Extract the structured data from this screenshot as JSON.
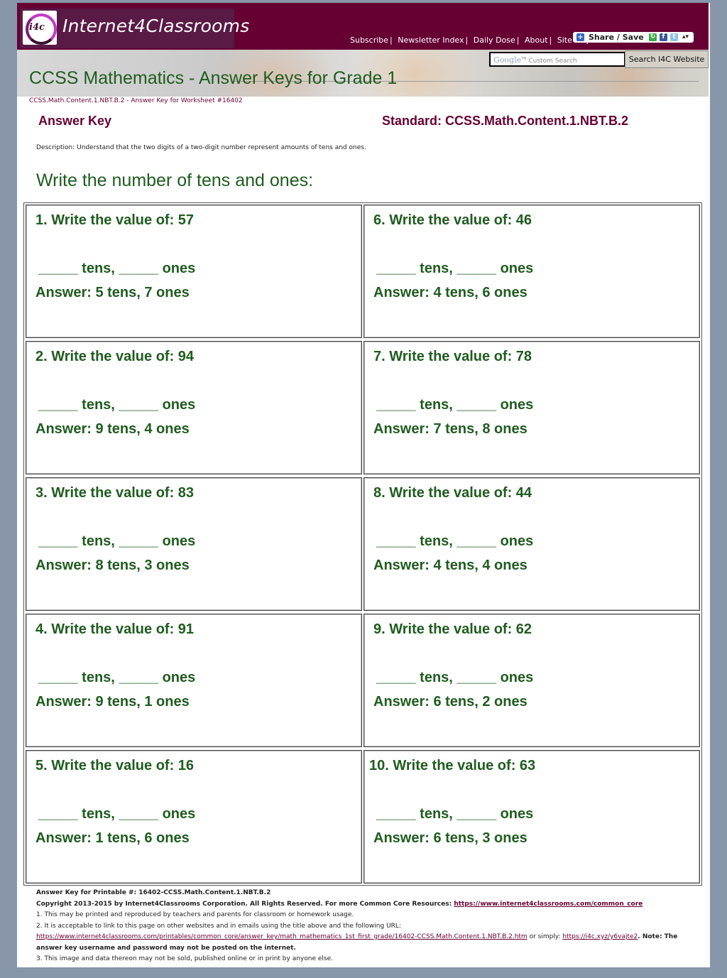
{
  "header": {
    "logo_badge": "i4c",
    "site_name": "Internet4Classrooms",
    "nav_links": [
      {
        "label": "Subscribe"
      },
      {
        "label": "Newsletter Index"
      },
      {
        "label": "Daily Dose"
      },
      {
        "label": "About"
      },
      {
        "label": "Site Map"
      }
    ],
    "share_label": "Share / Save",
    "share_icons": [
      "google-plus-icon",
      "facebook-icon",
      "twitter-icon"
    ],
    "search": {
      "brand": "Google",
      "placeholder": "Custom Search",
      "button_label": "Search I4C Website"
    },
    "page_title": "CCSS Mathematics - Answer Keys for Grade 1",
    "breadcrumb": "CCSS.Math.Content.1.NBT.B.2 - Answer Key for Worksheet #16402"
  },
  "main": {
    "answer_key_heading": "Answer Key",
    "standard_heading": "Standard: CCSS.Math.Content.1.NBT.B.2",
    "description": "Description: Understand that the two digits of a two-digit number represent amounts of tens and ones.",
    "worksheet_title": "Write the number of tens and ones:",
    "blank_template": "_____ tens, _____ ones",
    "problems": [
      {
        "number": 1,
        "question": "1. Write the value of: 57",
        "answer": "Answer: 5 tens, 7 ones"
      },
      {
        "number": 2,
        "question": "2. Write the value of: 94",
        "answer": "Answer: 9 tens, 4 ones"
      },
      {
        "number": 3,
        "question": "3. Write the value of: 83",
        "answer": "Answer: 8 tens, 3 ones"
      },
      {
        "number": 4,
        "question": "4. Write the value of: 91",
        "answer": "Answer: 9 tens, 1 ones"
      },
      {
        "number": 5,
        "question": "5. Write the value of: 16",
        "answer": "Answer: 1 tens, 6 ones"
      },
      {
        "number": 6,
        "question": "6. Write the value of: 46",
        "answer": "Answer: 4 tens, 6 ones"
      },
      {
        "number": 7,
        "question": "7. Write the value of: 78",
        "answer": "Answer: 7 tens, 8 ones"
      },
      {
        "number": 8,
        "question": "8. Write the value of: 44",
        "answer": "Answer: 4 tens, 4 ones"
      },
      {
        "number": 9,
        "question": "9. Write the value of: 62",
        "answer": "Answer: 6 tens, 2 ones"
      },
      {
        "number": 10,
        "question": "10. Write the value of: 63",
        "answer": "Answer: 6 tens, 3 ones"
      }
    ]
  },
  "footer": {
    "printable_line": "Answer Key for Printable #: 16402-CCSS.Math.Content.1.NBT.B.2",
    "copyright": "Copyright 2013-2015 by Internet4Classrooms Corporation. All Rights Reserved. For more Common Core Resources: ",
    "copyright_link": "https://www.internet4classrooms.com/common_core",
    "note1": "1. This may be printed and reproduced by teachers and parents for classroom or homework usage.",
    "note2": "2. It is acceptable to link to this page on other websites and in emails using the title above and the following URL:",
    "note2_url": "https://www.internet4classrooms.com/printables/common_core/answer_key/math_mathematics_1st_first_grade/16402-CCSS.Math.Content.1.NBT.B.2.htm",
    "note2_or": " or simply: ",
    "note2_short_url": "https://i4c.xyz/y6vajte2",
    "note2_tail": ". Note: The answer key username and password may not be posted on the internet.",
    "note3": "3. This image and data thereon may not be sold, published online or in print by anyone else."
  }
}
